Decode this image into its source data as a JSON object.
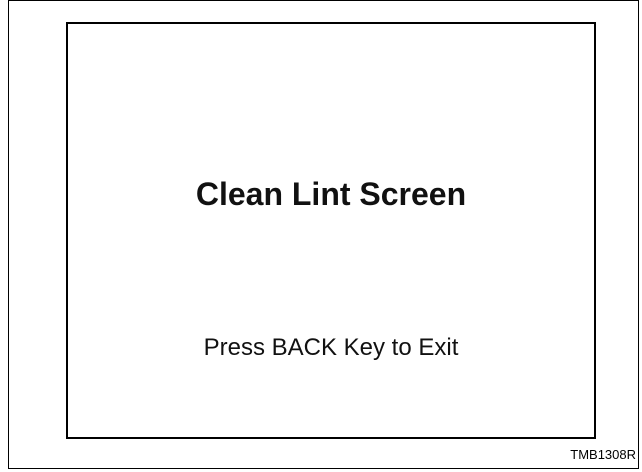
{
  "screen": {
    "title": "Clean Lint Screen",
    "instruction": "Press BACK Key to Exit"
  },
  "figure": {
    "code": "TMB1308R"
  }
}
